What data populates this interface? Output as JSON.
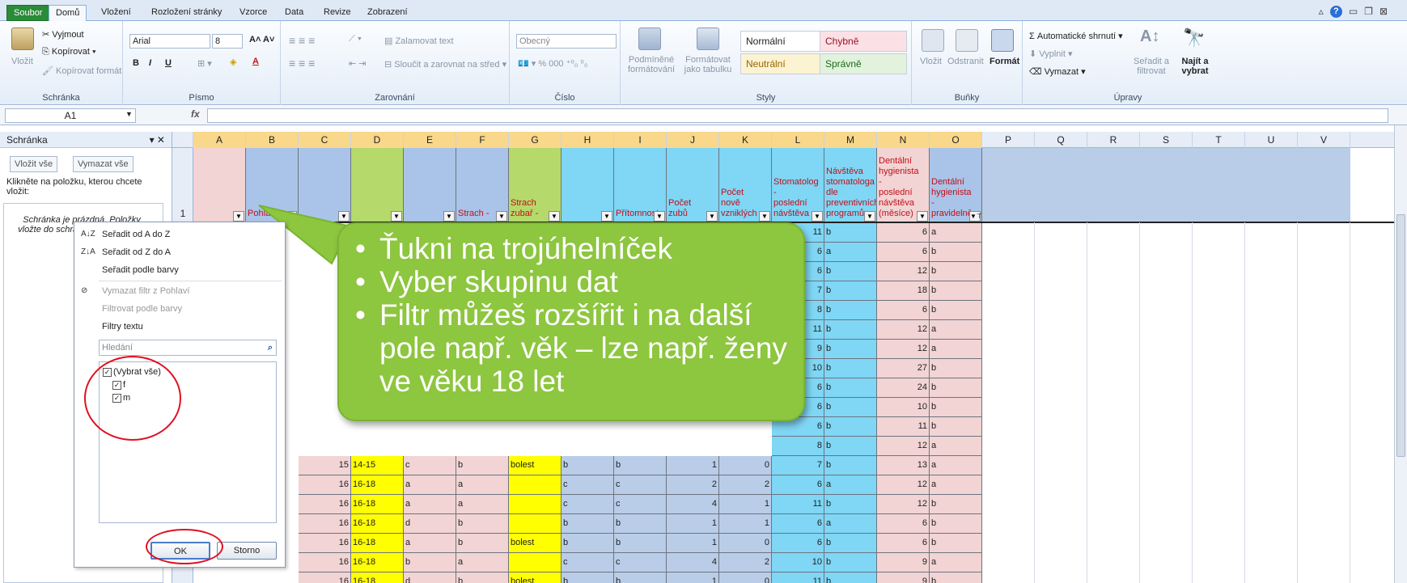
{
  "tabs": [
    {
      "label": "Soubor",
      "kind": "file"
    },
    {
      "label": "Domů",
      "kind": "active"
    },
    {
      "label": "Vložení"
    },
    {
      "label": "Rozložení stránky"
    },
    {
      "label": "Vzorce"
    },
    {
      "label": "Data"
    },
    {
      "label": "Revize"
    },
    {
      "label": "Zobrazení"
    }
  ],
  "ribbon": {
    "clipboard": {
      "paste": "Vložit",
      "cut": "Vyjmout",
      "copy": "Kopírovat",
      "format_painter": "Kopírovat formát",
      "label": "Schránka"
    },
    "font": {
      "name": "Arial",
      "size": "8",
      "label": "Písmo"
    },
    "alignment": {
      "wrap": "Zalamovat text",
      "merge": "Sloučit a zarovnat na střed",
      "label": "Zarovnání"
    },
    "number": {
      "format": "Obecný",
      "label": "Číslo"
    },
    "styles": {
      "conditional": "Podmíněné formátování",
      "as_table": "Formátovat jako tabulku",
      "normal": "Normální",
      "bad": "Chybně",
      "neutral": "Neutrální",
      "good": "Správně",
      "label": "Styly"
    },
    "cells": {
      "insert": "Vložit",
      "delete": "Odstranit",
      "format": "Formát",
      "label": "Buňky"
    },
    "editing": {
      "autosum": "Automatické shrnutí",
      "fill": "Vyplnit",
      "clear": "Vymazat",
      "sort": "Seřadit a filtrovat",
      "find": "Najít a vybrat",
      "label": "Úpravy"
    }
  },
  "formula": {
    "cell": "A1",
    "fx": "fx",
    "value": ""
  },
  "clip": {
    "title": "Schránka",
    "paste_all": "Vložit vše",
    "clear_all": "Vymazat vše",
    "instr": "Klikněte na položku, kterou chcete vložit:",
    "empty": "Schránka je prázdná. Položky vložte do schránky kopírováním."
  },
  "columns": [
    "A",
    "B",
    "C",
    "D",
    "E",
    "F",
    "G",
    "H",
    "I",
    "J",
    "K",
    "L",
    "M",
    "N",
    "O",
    "P",
    "Q",
    "R",
    "S",
    "T",
    "U",
    "V"
  ],
  "headers": {
    "B": "Pohlaví",
    "F": "Strach -",
    "G": "Strach zubař -",
    "I": "Přítomnost",
    "J": "Počet zubů",
    "K": "Počet nově vzniklých",
    "L": "Stomatolog - poslední návštěva",
    "M": "Návštěva stomatologa dle preventivních programů",
    "N": "Dentální hygienista - poslední návštěva (měsíce)",
    "O": "Dentální hygienista - pravidelně"
  },
  "row1": "1",
  "upper_rows": [
    {
      "L": "11",
      "M": "b",
      "N": "6",
      "O": "a"
    },
    {
      "L": "6",
      "M": "a",
      "N": "6",
      "O": "b"
    },
    {
      "L": "6",
      "M": "b",
      "N": "12",
      "O": "b"
    },
    {
      "L": "7",
      "M": "b",
      "N": "18",
      "O": "b"
    },
    {
      "L": "8",
      "M": "b",
      "N": "6",
      "O": "b"
    },
    {
      "L": "11",
      "M": "b",
      "N": "12",
      "O": "a"
    },
    {
      "L": "9",
      "M": "b",
      "N": "12",
      "O": "a"
    },
    {
      "L": "10",
      "M": "b",
      "N": "27",
      "O": "b"
    },
    {
      "L": "6",
      "M": "b",
      "N": "24",
      "O": "b"
    },
    {
      "L": "6",
      "M": "b",
      "N": "10",
      "O": "b"
    },
    {
      "L": "6",
      "M": "b",
      "N": "11",
      "O": "b"
    },
    {
      "L": "8",
      "M": "b",
      "N": "12",
      "O": "a"
    }
  ],
  "lower_rows": [
    {
      "C": "15",
      "D": "14-15",
      "E": "c",
      "F": "b",
      "G": "bolest",
      "H": "b",
      "I": "b",
      "J": "1",
      "K": "0",
      "L": "7",
      "M": "b",
      "N": "13",
      "O": "a"
    },
    {
      "C": "16",
      "D": "16-18",
      "E": "a",
      "F": "a",
      "G": "",
      "H": "c",
      "I": "c",
      "J": "2",
      "K": "2",
      "L": "6",
      "M": "a",
      "N": "12",
      "O": "a"
    },
    {
      "C": "16",
      "D": "16-18",
      "E": "a",
      "F": "a",
      "G": "",
      "H": "c",
      "I": "c",
      "J": "4",
      "K": "1",
      "L": "11",
      "M": "b",
      "N": "12",
      "O": "b"
    },
    {
      "C": "16",
      "D": "16-18",
      "E": "d",
      "F": "b",
      "G": "",
      "H": "b",
      "I": "b",
      "J": "1",
      "K": "1",
      "L": "6",
      "M": "a",
      "N": "6",
      "O": "b"
    },
    {
      "C": "16",
      "D": "16-18",
      "E": "a",
      "F": "b",
      "G": "bolest",
      "H": "b",
      "I": "b",
      "J": "1",
      "K": "0",
      "L": "6",
      "M": "b",
      "N": "6",
      "O": "b"
    },
    {
      "C": "16",
      "D": "16-18",
      "E": "b",
      "F": "a",
      "G": "",
      "H": "c",
      "I": "c",
      "J": "4",
      "K": "2",
      "L": "10",
      "M": "b",
      "N": "9",
      "O": "a"
    },
    {
      "C": "16",
      "D": "16-18",
      "E": "d",
      "F": "b",
      "G": "bolest",
      "H": "b",
      "I": "b",
      "J": "1",
      "K": "0",
      "L": "11",
      "M": "b",
      "N": "9",
      "O": "b"
    }
  ],
  "filter": {
    "sort_az": "Seřadit od A do Z",
    "sort_za": "Seřadit od Z do A",
    "sort_color": "Seřadit podle barvy",
    "clear": "Vymazat filtr z Pohlaví",
    "by_color": "Filtrovat podle barvy",
    "text_filters": "Filtry textu",
    "search": "Hledání",
    "items": [
      "(Vybrat vše)",
      "f",
      "m"
    ],
    "ok": "OK",
    "cancel": "Storno"
  },
  "callout": [
    "Ťukni na trojúhelníček",
    "Vyber skupinu dat",
    "Filtr můžeš rozšířit i na další pole např. věk – lze např. ženy ve věku 18 let"
  ],
  "colors": {
    "callout": "#8dc63f",
    "circle": "#e01020",
    "pink": "#f2d4d4",
    "blue_hdr": "#a9c4e8",
    "green_hdr": "#b5d96b",
    "cyan": "#7fd6f5",
    "yellow": "#ffff00",
    "lightblue": "#b9cde8"
  }
}
